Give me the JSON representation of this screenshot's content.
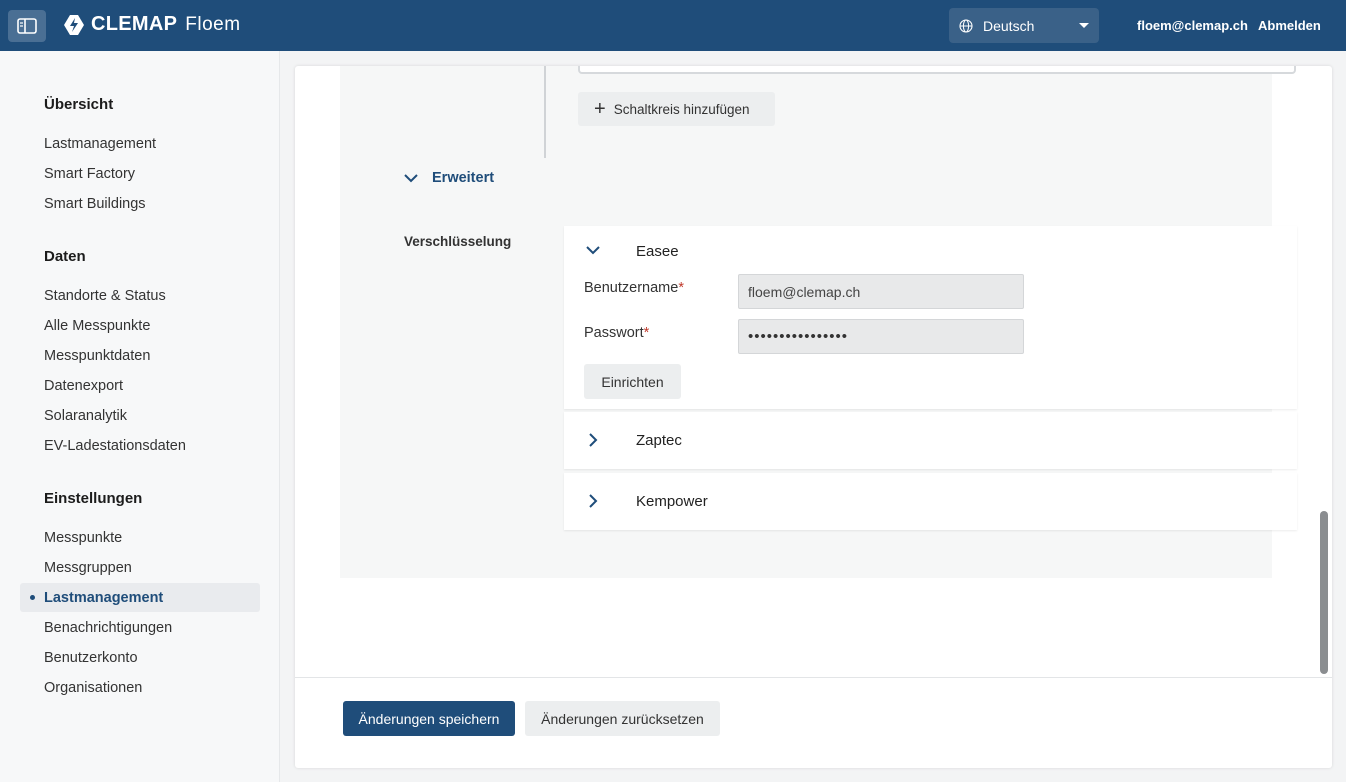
{
  "header": {
    "brand_name": "CLEMAP",
    "product_name": "Floem",
    "language": "Deutsch",
    "user_email": "floem@clemap.ch",
    "logout_label": "Abmelden",
    "accent_color": "#1f4d7a"
  },
  "sidebar": {
    "sections": [
      {
        "title": "Übersicht",
        "items": [
          "Lastmanagement",
          "Smart Factory",
          "Smart Buildings"
        ]
      },
      {
        "title": "Daten",
        "items": [
          "Standorte & Status",
          "Alle Messpunkte",
          "Messpunktdaten",
          "Datenexport",
          "Solaranalytik",
          "EV-Ladestationsdaten"
        ]
      },
      {
        "title": "Einstellungen",
        "items": [
          "Messpunkte",
          "Messgruppen",
          "Lastmanagement",
          "Benachrichtigungen",
          "Benutzerkonto",
          "Organisationen"
        ]
      }
    ],
    "active_item": "Einstellungen / Lastmanagement"
  },
  "main": {
    "add_circuit_label": "Schaltkreis hinzufügen",
    "advanced_label": "Erweitert",
    "encryption_label": "Verschlüsselung",
    "providers": [
      {
        "name": "Easee",
        "expanded": true,
        "username_label": "Benutzername",
        "username_value": "floem@clemap.ch",
        "password_label": "Passwort",
        "password_mask": "••••••••••••••••",
        "setup_label": "Einrichten"
      },
      {
        "name": "Zaptec",
        "expanded": false
      },
      {
        "name": "Kempower",
        "expanded": false
      }
    ],
    "required_marker": "*"
  },
  "footer": {
    "save_label": "Änderungen speichern",
    "reset_label": "Änderungen zurücksetzen"
  }
}
